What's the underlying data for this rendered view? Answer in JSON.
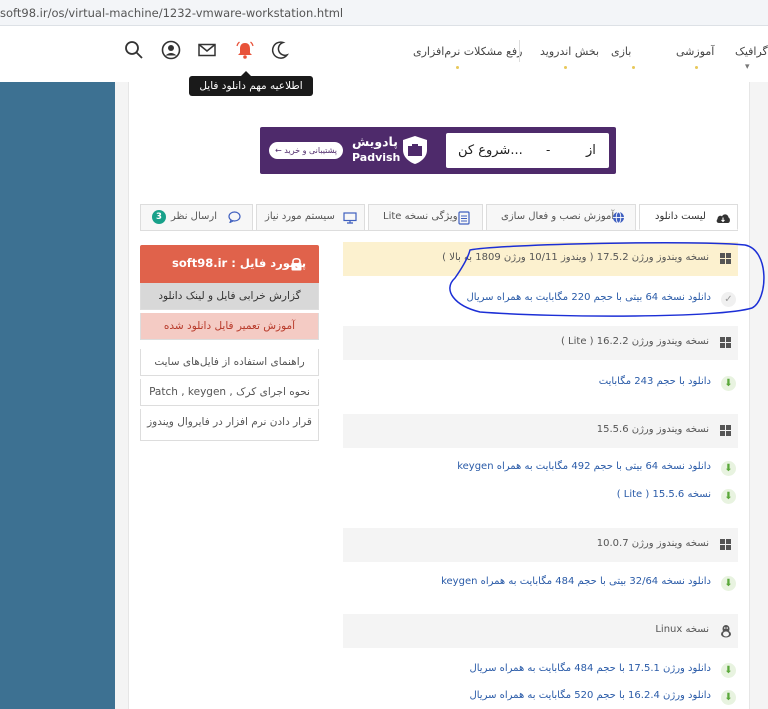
{
  "url": "soft98.ir/os/virtual-machine/1232-vmware-workstation.html",
  "nav": {
    "menu": [
      {
        "label": "گرافیک"
      },
      {
        "label": "آموزشی"
      },
      {
        "label": "بازی"
      },
      {
        "label": "بخش اندروید"
      },
      {
        "label": "رفع مشکلات نرم‌افزاری"
      }
    ],
    "tooltip": "اطلاعیه مهم دانلود فایل"
  },
  "banner": {
    "brand_fa": "پادویش",
    "brand_en": "Padvish",
    "pill": "پشتیبانی و خرید",
    "search_start": "شروع کن...",
    "search_dash": "-",
    "search_from": "از"
  },
  "tabs": [
    {
      "label": "لیست دانلود",
      "icon": "cloud-icon"
    },
    {
      "label": "آموزش نصب و فعال سازی",
      "icon": "globe-icon"
    },
    {
      "label": "ویژگی نسخه Lite",
      "icon": "document-icon"
    },
    {
      "label": "سیستم مورد نیاز",
      "icon": "monitor-icon"
    },
    {
      "label": "ارسال نظر",
      "icon": "comment-icon",
      "badge": "3"
    }
  ],
  "sidebar": {
    "password_label": "پسورد فایل : soft98.ir",
    "buttons": [
      "گزارش خرابی فایل و لینک دانلود",
      "آموزش تعمیر فایل دانلود شده",
      "راهنمای استفاده از فایل‌های سایت",
      "نحوه اجرای کرک , Patch , keygen",
      "قرار دادن نرم افزار در فایروال ویندوز"
    ]
  },
  "downloads": {
    "sections": [
      {
        "title": "نسخه ویندوز ورژن 17.5.2 ( ویندوز 10/11 ورژن 1809 به بالا )",
        "links": [
          "دانلود نسخه 64 بیتی با حجم 220 مگابایت به همراه سریال"
        ]
      },
      {
        "title": "نسخه ویندوز ورژن 16.2.2 ( Lite )",
        "links": [
          "دانلود با حجم 243 مگابایت"
        ]
      },
      {
        "title": "نسخه ویندوز ورژن 15.5.6",
        "links": [
          "دانلود نسخه 64 بیتی با حجم 492 مگابایت به همراه keygen",
          "نسخه 15.5.6 ( Lite )"
        ]
      },
      {
        "title": "نسخه ویندوز ورژن 10.0.7",
        "links": [
          "دانلود نسخه 32/64 بیتی با حجم 484 مگابایت به همراه keygen"
        ]
      },
      {
        "title": "نسخه Linux",
        "links": [
          "دانلود ورژن 17.5.1 با حجم 484 مگابایت به همراه سریال",
          "دانلود ورژن 16.2.4 با حجم 520 مگابایت به همراه سریال"
        ]
      }
    ]
  },
  "colors": {
    "sidebar_blue": "#3d7192",
    "banner_purple": "#4e2a6b",
    "password_red": "#e0624b",
    "link_blue": "#2a5ba8",
    "annotation": "#1c2fd6"
  }
}
